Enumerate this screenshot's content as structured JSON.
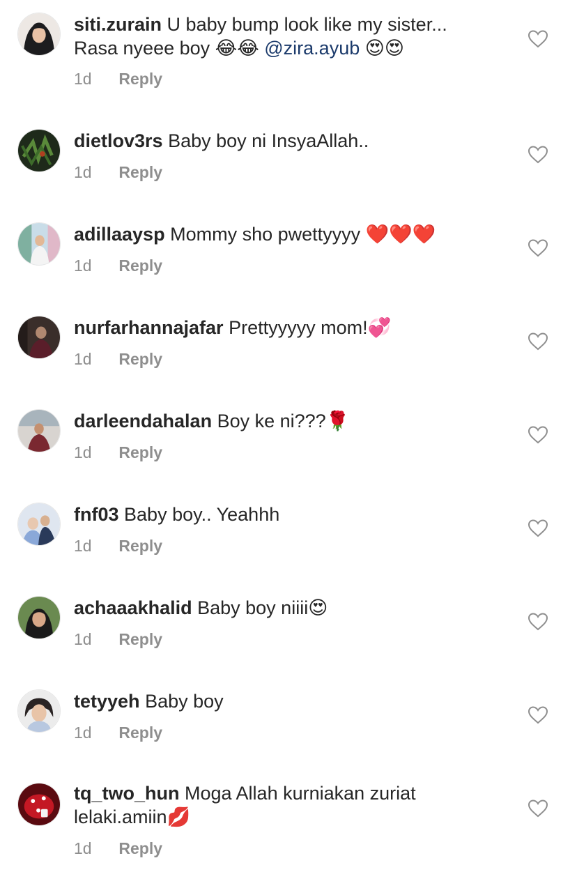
{
  "comments": [
    {
      "username": "siti.zurain",
      "line1": "U baby bump look like my sister...",
      "line2_text": "Rasa nyeee boy ",
      "line2_emoji": "😂😂",
      "mention": "@zira.ayub",
      "line2_tail_emoji": "😍😍",
      "time": "1d",
      "reply": "Reply",
      "avatar": "avatar-hijab-woman"
    },
    {
      "username": "dietlov3rs",
      "text": "Baby boy ni InsyaAllah..",
      "time": "1d",
      "reply": "Reply",
      "avatar": "avatar-food-dish"
    },
    {
      "username": "adillaaysp",
      "text": "Mommy sho pwettyyyy ",
      "emoji": "❤️❤️❤️",
      "time": "1d",
      "reply": "Reply",
      "avatar": "avatar-woman-outdoor"
    },
    {
      "username": "nurfarhannajafar",
      "text": "Prettyyyyy mom!",
      "emoji": "💞",
      "time": "1d",
      "reply": "Reply",
      "avatar": "avatar-dark-photo"
    },
    {
      "username": "darleendahalan",
      "text": "Boy ke ni???",
      "emoji": "🌹",
      "time": "1d",
      "reply": "Reply",
      "avatar": "avatar-woman-street"
    },
    {
      "username": "fnf03",
      "text": "Baby boy.. Yeahhh",
      "time": "1d",
      "reply": "Reply",
      "avatar": "avatar-group-photo"
    },
    {
      "username": "achaaakhalid",
      "text": "Baby boy niiii",
      "emoji": "😍",
      "time": "1d",
      "reply": "Reply",
      "avatar": "avatar-woman-portrait"
    },
    {
      "username": "tetyyeh",
      "text": "Baby boy",
      "time": "1d",
      "reply": "Reply",
      "avatar": "avatar-woman-selfie"
    },
    {
      "username": "tq_two_hun",
      "line1": "Moga Allah kurniakan zuriat",
      "line2_text": "lelaki.amiin",
      "emoji": "💋",
      "time": "1d",
      "reply": "Reply",
      "avatar": "avatar-cake"
    }
  ]
}
